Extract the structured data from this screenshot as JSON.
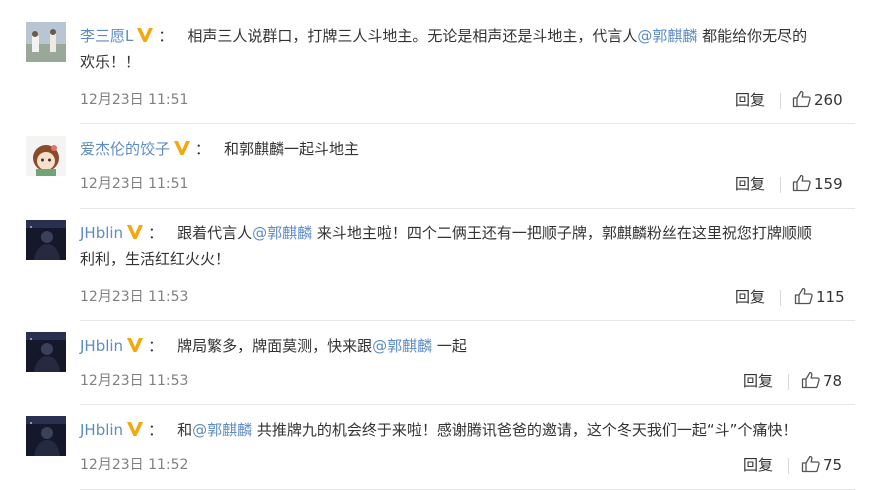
{
  "comments": [
    {
      "user": "李三愿L",
      "parts": [
        "相声三人说群口，打牌三人斗地主。无论是相声还是斗地主，代言人",
        "@郭麒麟",
        " 都能给你无尽的"
      ],
      "line2": "欢乐！！",
      "time": "12月23日 11:51",
      "reply": "回复",
      "likes": "260"
    },
    {
      "user": "爱杰伦的饺子",
      "parts": [
        "和郭麒麟一起斗地主"
      ],
      "time": "12月23日 11:51",
      "reply": "回复",
      "likes": "159"
    },
    {
      "user": "JHblin",
      "parts": [
        "跟着代言人",
        "@郭麒麟",
        " 来斗地主啦！四个二俩王还有一把顺子牌，郭麒麟粉丝在这里祝您打牌顺顺"
      ],
      "line2": "利利，生活红红火火！",
      "time": "12月23日 11:53",
      "reply": "回复",
      "likes": "115"
    },
    {
      "user": "JHblin",
      "parts": [
        "牌局繁多，牌面莫测，快来跟",
        "@郭麒麟",
        " 一起"
      ],
      "time": "12月23日 11:53",
      "reply": "回复",
      "likes": "78"
    },
    {
      "user": "JHblin",
      "parts": [
        "和",
        "@郭麒麟",
        " 共推牌九的机会终于来啦！感谢腾讯爸爸的邀请，这个冬天我们一起“斗”个痛快！"
      ],
      "time": "12月23日 11:52",
      "reply": "回复",
      "likes": "75"
    }
  ],
  "colors": {
    "link": "#5d8cc4",
    "text": "#333333",
    "meta": "#808080",
    "badge": "#f4a80b"
  },
  "icons": {
    "verified": "verified-v-badge-icon",
    "like": "thumbs-up-icon"
  },
  "colon": "："
}
